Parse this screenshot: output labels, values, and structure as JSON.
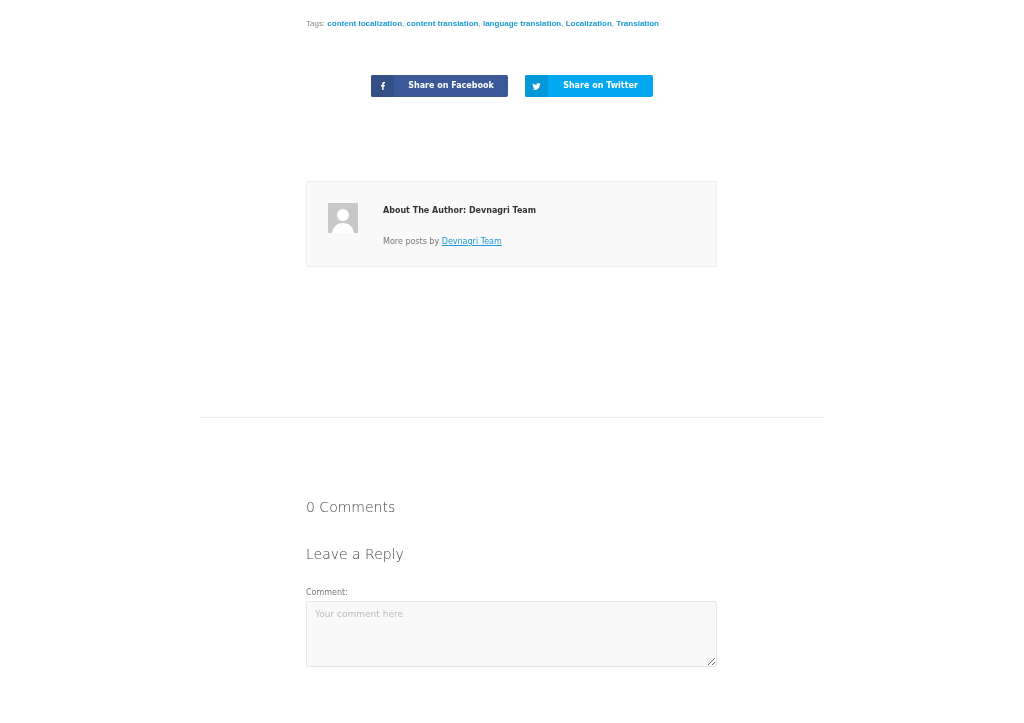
{
  "tags": {
    "label": "Tags:",
    "separator": ",",
    "items": [
      "content localization",
      "content translation",
      "language translation",
      "Localization",
      "Translation"
    ]
  },
  "share_buttons": [
    {
      "kind": "facebook",
      "label": "Share on Facebook"
    },
    {
      "kind": "twitter",
      "label": "Share on Twitter"
    }
  ],
  "author_box": {
    "title": "About The Author: Devnagri Team",
    "more_posts_prefix": "More posts by",
    "more_posts_link": "Devnagri Team"
  },
  "comments": {
    "count_heading": "0 Comments",
    "reply_heading": "Leave a Reply",
    "field_label": "Comment:",
    "placeholder": "Your comment here"
  }
}
